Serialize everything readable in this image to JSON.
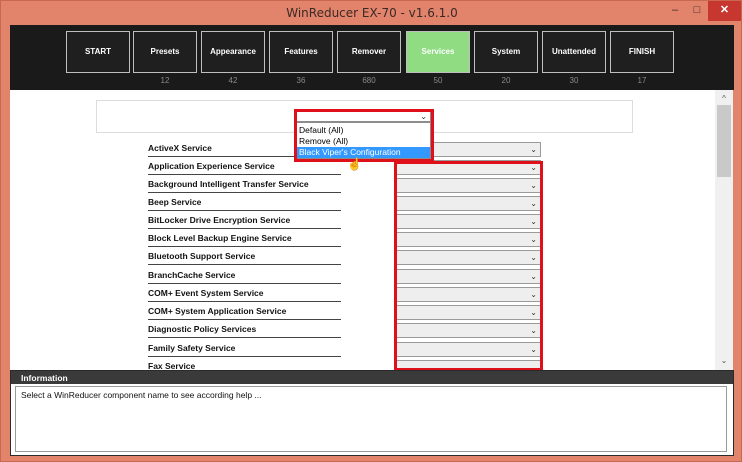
{
  "window": {
    "title": "WinReducer EX-70 - v1.6.1.0",
    "minimize_glyph": "–",
    "maximize_glyph": "□",
    "close_glyph": "✕"
  },
  "steps": [
    {
      "label": "START",
      "count": ""
    },
    {
      "label": "Presets",
      "count": "12"
    },
    {
      "label": "Appearance",
      "count": "42"
    },
    {
      "label": "Features",
      "count": "36"
    },
    {
      "label": "Remover",
      "count": "680"
    },
    {
      "label": "Services",
      "count": "50"
    },
    {
      "label": "System",
      "count": "20"
    },
    {
      "label": "Unattended",
      "count": "30"
    },
    {
      "label": "FINISH",
      "count": "17"
    }
  ],
  "active_step": "Services",
  "preset_dropdown": {
    "selected": "",
    "options": [
      "Default (All)",
      "Remove (All)",
      "Black Viper's Configuration"
    ],
    "highlighted": "Black Viper's Configuration"
  },
  "services": [
    "ActiveX Service",
    "Application Experience Service",
    "Background Intelligent Transfer Service",
    "Beep Service",
    "BitLocker Drive Encryption Service",
    "Block Level Backup Engine Service",
    "Bluetooth Support Service",
    "BranchCache Service",
    "COM+ Event System Service",
    "COM+ System Application Service",
    "Diagnostic Policy Services",
    "Family Safety Service",
    "Fax Service"
  ],
  "select_arrow": "⌄",
  "scroll": {
    "up": "^",
    "down": "⌄"
  },
  "information": {
    "title": "Information",
    "text": "Select a WinReducer component name to see according help ..."
  },
  "colors": {
    "frame": "#e2836b",
    "active_step": "#8fdc82",
    "highlight": "#e0101a",
    "selection": "#3399ff"
  }
}
